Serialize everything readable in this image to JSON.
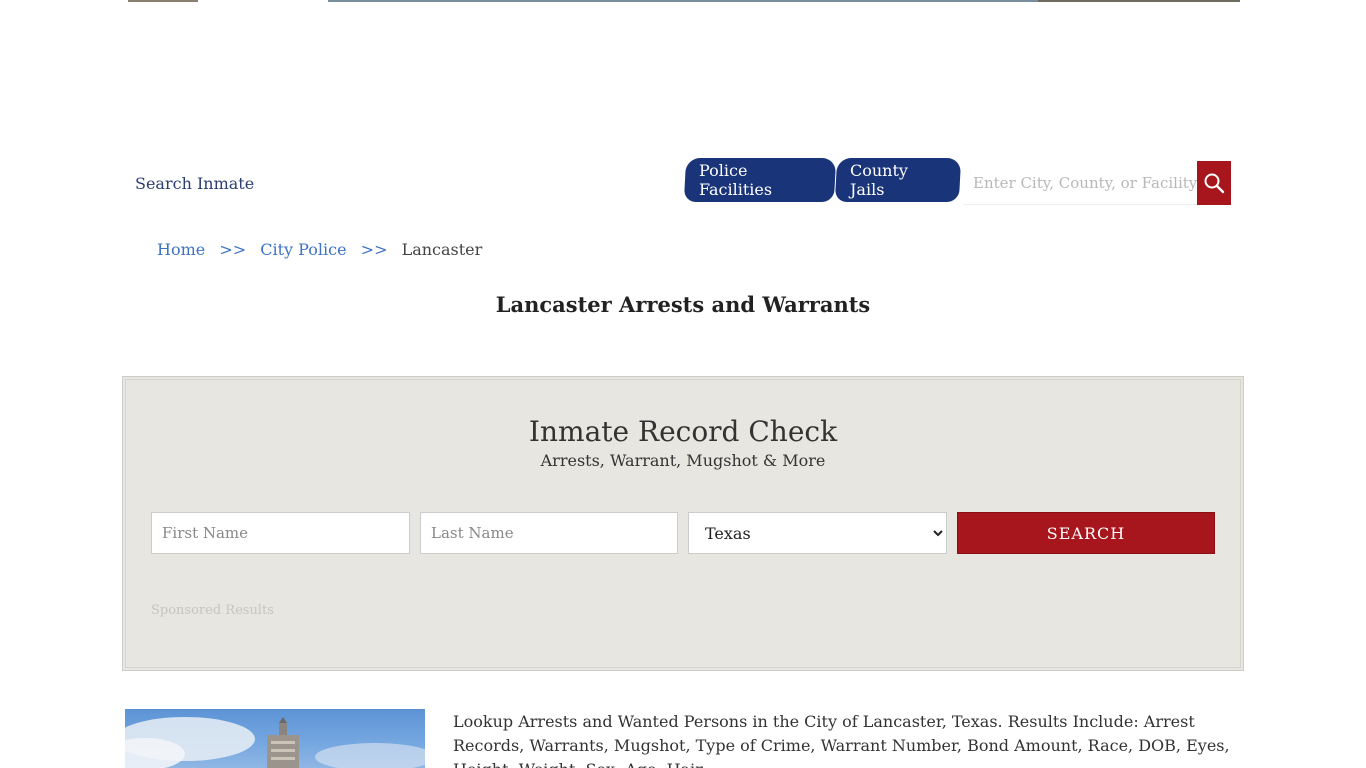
{
  "nav": {
    "search_inmate": "Search Inmate",
    "tabs": [
      "Police Facilities",
      "County Jails"
    ],
    "search_placeholder": "Enter City, County, or Facility"
  },
  "breadcrumb": {
    "home": "Home",
    "separator": ">>",
    "city_police": "City Police",
    "current": "Lancaster"
  },
  "page_title": "Lancaster Arrests and Warrants",
  "record_check": {
    "title": "Inmate Record Check",
    "subtitle": "Arrests, Warrant, Mugshot & More",
    "first_name_placeholder": "First Name",
    "last_name_placeholder": "Last Name",
    "state_selected": "Texas",
    "search_label": "SEARCH",
    "sponsored": "Sponsored Results"
  },
  "description": "Lookup Arrests and Wanted Persons in the City of Lancaster, Texas. Results Include: Arrest Records, Warrants, Mugshot, Type of Crime, Warrant Number, Bond Amount, Race, DOB, Eyes, Height, Weight, Sex, Age, Hair.",
  "colors": {
    "nav_tab": "#1a3479",
    "accent_red": "#a8161d",
    "link_blue": "#3d72c4",
    "box_bg": "#e8e6e1"
  }
}
